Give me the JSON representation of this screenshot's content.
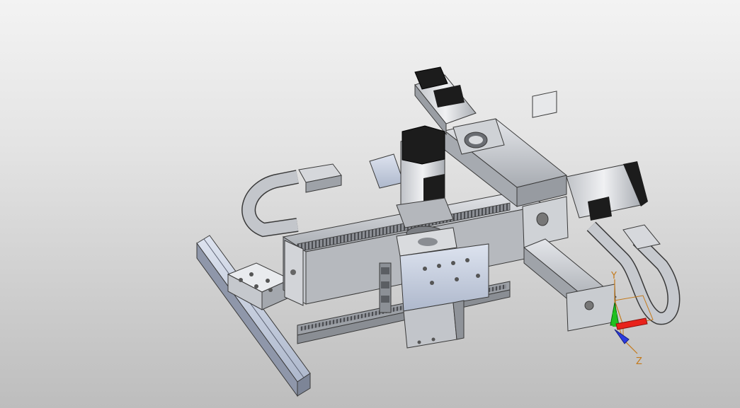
{
  "viewport": {
    "background_top": "#f3f3f3",
    "background_bottom": "#bdbdbd"
  },
  "model": {
    "colors": {
      "metal_light": "#d8dadd",
      "metal_mid": "#b9bcc2",
      "metal_dark": "#8d9096",
      "steel_blue": "#c7cfe0",
      "motor_black": "#1c1c1c",
      "edge": "#3a3a3a"
    }
  },
  "triad": {
    "y_label": "Y",
    "z_label": "Z",
    "colors": {
      "x_axis": "#e8221b",
      "y_axis": "#20c020",
      "z_axis": "#2c3be0",
      "label": "#c47a1b"
    }
  }
}
